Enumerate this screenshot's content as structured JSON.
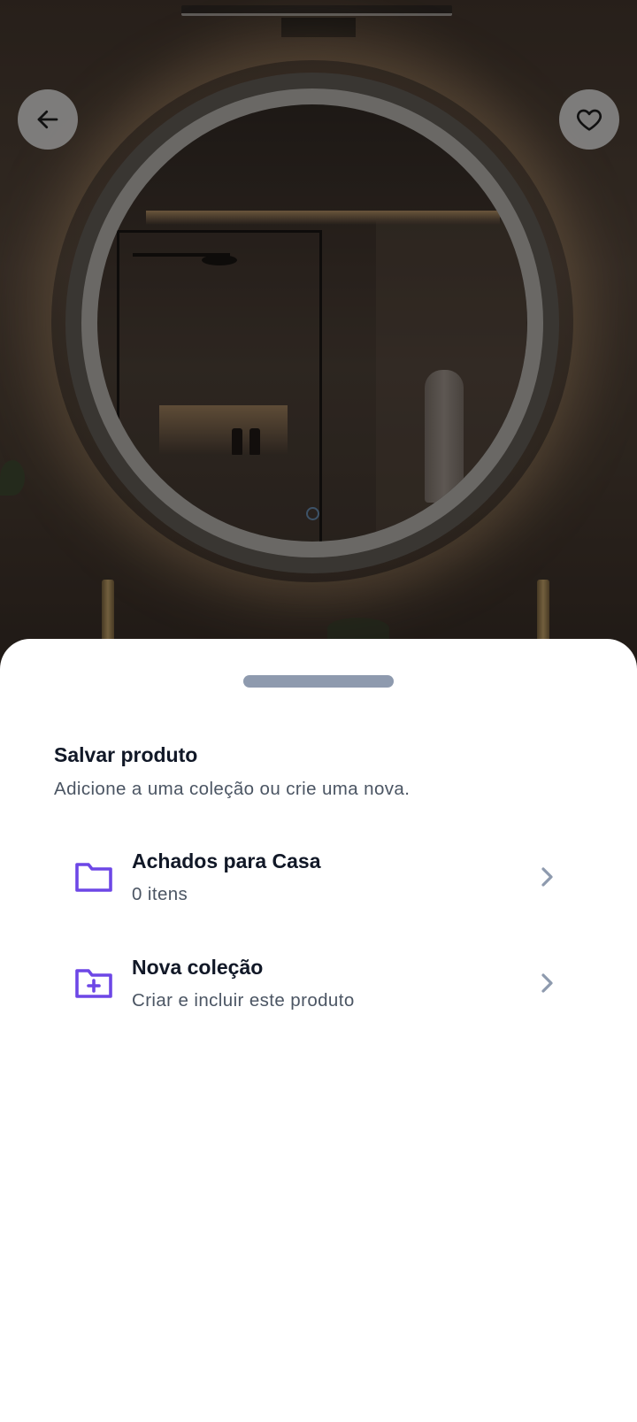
{
  "header": {
    "back_icon": "arrow-left-icon",
    "favorite_icon": "heart-outline-icon"
  },
  "photo": {
    "subject": "round illuminated bathroom mirror",
    "touch_sensor_color": "#5b7a99"
  },
  "sheet": {
    "title": "Salvar produto",
    "subtitle": "Adicione a uma coleção ou crie uma nova.",
    "items": [
      {
        "title": "Achados para Casa",
        "subtitle": "0 itens",
        "icon": "folder-icon"
      },
      {
        "title": "Nova coleção",
        "subtitle": "Criar e incluir este produto",
        "icon": "folder-plus-icon"
      }
    ]
  },
  "colors": {
    "accent": "#6d47e6",
    "handle": "#8e9aae",
    "chevron": "#8e9aae",
    "title_text": "#111827",
    "secondary_text": "#4b5563"
  }
}
